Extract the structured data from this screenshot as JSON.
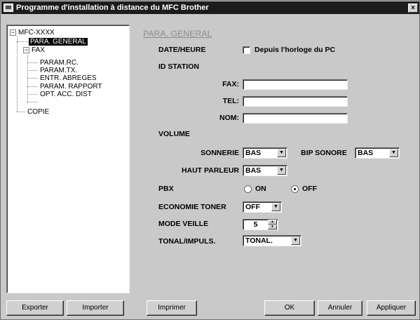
{
  "window": {
    "title": "Programme d'installation à distance du MFC Brother",
    "close_glyph": "×"
  },
  "tree": {
    "root": "MFC-XXXX",
    "items": [
      {
        "label": "PARA. GENERAL",
        "selected": true
      },
      {
        "label": "FAX",
        "expander": "−"
      },
      {
        "label": "PARAM.RC."
      },
      {
        "label": "PARAM.TX."
      },
      {
        "label": "ENTR. ABREGES"
      },
      {
        "label": "PARAM. RAPPORT"
      },
      {
        "label": "OPT. ACC. DIST"
      },
      {
        "label": "COPIE"
      }
    ],
    "root_expander": "−"
  },
  "panel": {
    "title": "PARA. GENERAL",
    "date_heure_label": "DATE/HEURE",
    "pc_clock_label": "Depuis l'horloge du PC",
    "id_station_label": "ID STATION",
    "fax_label": "FAX:",
    "fax_value": "",
    "tel_label": "TEL:",
    "tel_value": "",
    "nom_label": "NOM:",
    "nom_value": "",
    "volume_label": "VOLUME",
    "sonnerie_label": "SONNERIE",
    "sonnerie_value": "BAS",
    "bip_label": "BIP SONORE",
    "bip_value": "BAS",
    "haut_parleur_label": "HAUT PARLEUR",
    "haut_parleur_value": "BAS",
    "pbx_label": "PBX",
    "pbx_on": "ON",
    "pbx_off": "OFF",
    "pbx_selected": "OFF",
    "toner_label": "ECONOMIE TONER",
    "toner_value": "OFF",
    "veille_label": "MODE VEILLE",
    "veille_value": "5",
    "tonal_label": "TONAL/IMPULS.",
    "tonal_value": "TONAL.",
    "dropdown_glyph": "▼",
    "spin_up": "▲",
    "spin_down": "▼"
  },
  "buttons": {
    "export": "Exporter",
    "import": "Importer",
    "print": "Imprimer",
    "ok": "OK",
    "cancel": "Annuler",
    "apply": "Appliquer"
  }
}
